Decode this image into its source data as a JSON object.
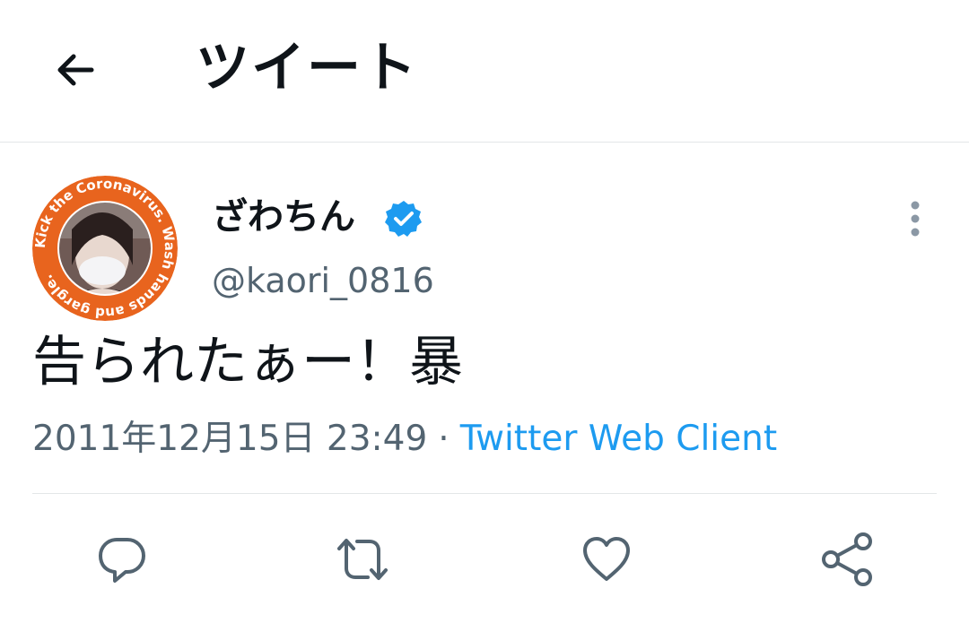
{
  "header": {
    "title": "ツイート",
    "back_icon": "arrow-left-icon"
  },
  "tweet": {
    "avatar_ring_text": "Kick the Coronavirus. Wash hands and gargle.",
    "avatar_ring_color": "#e8641e",
    "display_name": "ざわちん",
    "verified": true,
    "verified_color": "#1d9bf0",
    "handle": "@kaori_0816",
    "text": "告られたぁー！暴",
    "timestamp": "2011年12月15日 23:49",
    "separator": "·",
    "client": "Twitter Web Client",
    "client_color": "#1d9bf0"
  },
  "actions": [
    {
      "icon": "reply-icon"
    },
    {
      "icon": "retweet-icon"
    },
    {
      "icon": "like-icon"
    },
    {
      "icon": "share-icon"
    }
  ]
}
